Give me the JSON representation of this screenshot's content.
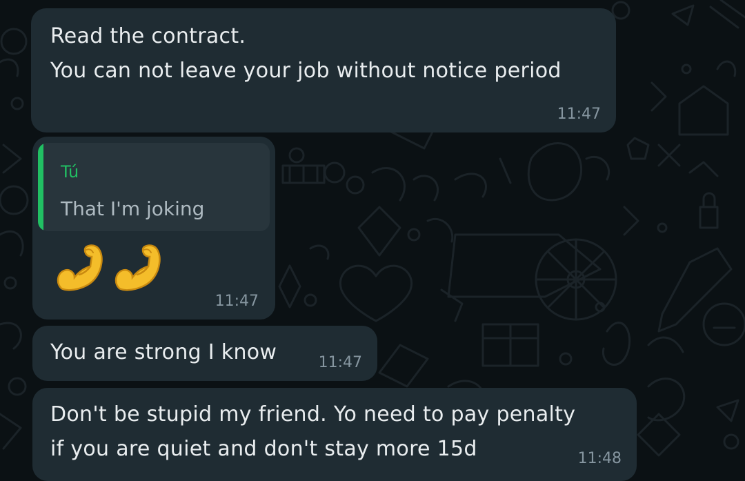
{
  "chat": {
    "messages": [
      {
        "lines": [
          "Read the contract.",
          "You can not leave your job without notice period"
        ],
        "time": "11:47"
      },
      {
        "reply_to": {
          "author": "Tú",
          "text": "That I'm joking"
        },
        "emoji": [
          "flexed-biceps-icon",
          "flexed-biceps-icon"
        ],
        "time": "11:47"
      },
      {
        "lines": [
          "You are strong I know"
        ],
        "time": "11:47"
      },
      {
        "lines": [
          "Don't be stupid my friend.  Yo need to pay penalty",
          "if you are quiet and don't stay more 15d"
        ],
        "time": "11:48"
      }
    ]
  },
  "colors": {
    "background": "#0b1114",
    "bubble": "#1f2c33",
    "quote_background": "#28353c",
    "quote_accent": "#21c063",
    "text": "#e9edef",
    "timestamp": "#8696a0"
  }
}
